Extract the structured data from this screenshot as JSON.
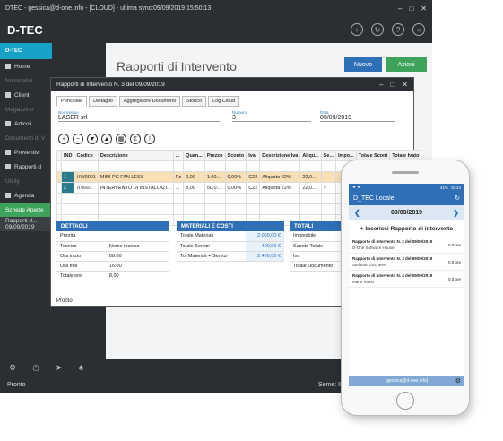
{
  "window": {
    "title": "DTEC - gessica@d-one.info - [CLOUD] - ultima sync:09/09/2019 15:50:13"
  },
  "appbar": {
    "brand": "D-TEC"
  },
  "sidebar": {
    "head": "D-TEC",
    "items": [
      {
        "label": "Home",
        "type": "item"
      },
      {
        "label": "Nominativi",
        "type": "section"
      },
      {
        "label": "Clienti",
        "type": "item"
      },
      {
        "label": "Magazzino",
        "type": "section"
      },
      {
        "label": "Articoli",
        "type": "item"
      },
      {
        "label": "Documenti di V",
        "type": "section"
      },
      {
        "label": "Preventivi",
        "type": "item"
      },
      {
        "label": "Rapporti d",
        "type": "item"
      },
      {
        "label": "Utility",
        "type": "section"
      },
      {
        "label": "Agenda",
        "type": "item"
      },
      {
        "label": "Schede Aperte",
        "type": "active"
      },
      {
        "label": "Rapporti d... 09/09/2019",
        "type": "current"
      }
    ]
  },
  "main": {
    "title": "Rapporti di Intervento",
    "btn_nuovo": "Nuovo",
    "btn_azioni": "Azioni"
  },
  "dialog": {
    "title": "Rapporti di Intervento N. 3 del 09/09/2019",
    "tabs": [
      "Principale",
      "Dettaglio",
      "Aggregatore Documenti",
      "Storico",
      "Log Cloud"
    ],
    "nominativo_label": "Nominativo",
    "nominativo_value": "LASER srl",
    "numero_label": "Numero",
    "numero_value": "3",
    "data_label": "Data",
    "data_value": "09/09/2019",
    "grid": {
      "headers": [
        "",
        "IND",
        "Codice",
        "Descrizione",
        "...",
        "Quan...",
        "Prezzo",
        "Sconto",
        "Iva",
        "Descrizione Iva",
        "Aliqu...",
        "Se...",
        "Impo...",
        "Totale Scont",
        "Totale Ivato"
      ],
      "rows": [
        [
          "",
          "1",
          "HW0001",
          "MINI PC FAN LESS",
          "Pz",
          "2,00",
          "1.00...",
          "0,00%",
          "C22",
          "Aliquota 22%",
          "22,0...",
          "",
          "",
          "",
          ""
        ],
        [
          "",
          "2",
          "IT0001",
          "INTERVENTO DI INSTALLAZI...",
          "...",
          "8,00",
          "50,0...",
          "0,00%",
          "C22",
          "Aliquota 22%",
          "22,0...",
          "✓",
          "",
          "",
          ""
        ]
      ]
    },
    "dettagli": {
      "title": "DETTAGLI",
      "rows": [
        [
          "Priorità",
          ""
        ],
        [
          "Tecnico",
          "Nome tecnico"
        ],
        [
          "Ora inizio",
          "08:00"
        ],
        [
          "Ora fine",
          "16:00"
        ],
        [
          "Totale ore",
          "8,00"
        ]
      ]
    },
    "materiali": {
      "title": "MATERIALI E COSTI",
      "rows": [
        [
          "Totale Materiali",
          "2.000,00 €"
        ],
        [
          "Totale Servizi",
          "400,00 €"
        ],
        [
          "Tot Materiali + Servizi",
          "2.400,00 €"
        ]
      ]
    },
    "totali": {
      "title": "TOTALI",
      "rows": [
        [
          "Imponibile",
          ""
        ],
        [
          "Sconto Totale",
          ""
        ],
        [
          "Iva",
          ""
        ],
        [
          "Totale Documento",
          ""
        ]
      ]
    },
    "footer": "Pronto"
  },
  "status": {
    "left": "Pronto",
    "right": "Seme: INTERVTEC   Utente: gessica@"
  },
  "phone": {
    "status_time": "15:24",
    "status_battery": "41%",
    "title": "D_TEC Locale",
    "date": "09/09/2019",
    "add_label": "+ Inserisci Rapporto di intervento",
    "items": [
      {
        "title": "Rapporto di intervento N. 2 del 09/09/2019",
        "sub": "D-One Software House",
        "hours": "0.0 ore"
      },
      {
        "title": "Rapporto di intervento N. 3 del 09/09/2019",
        "sub": "Stefania Lucchese",
        "hours": "0.0 ore"
      },
      {
        "title": "Rapporto di intervento N. 4 del 09/09/2019",
        "sub": "Mario Rossi",
        "hours": "0.0 ore"
      }
    ],
    "footer": "[gessica@d-one.info]"
  }
}
